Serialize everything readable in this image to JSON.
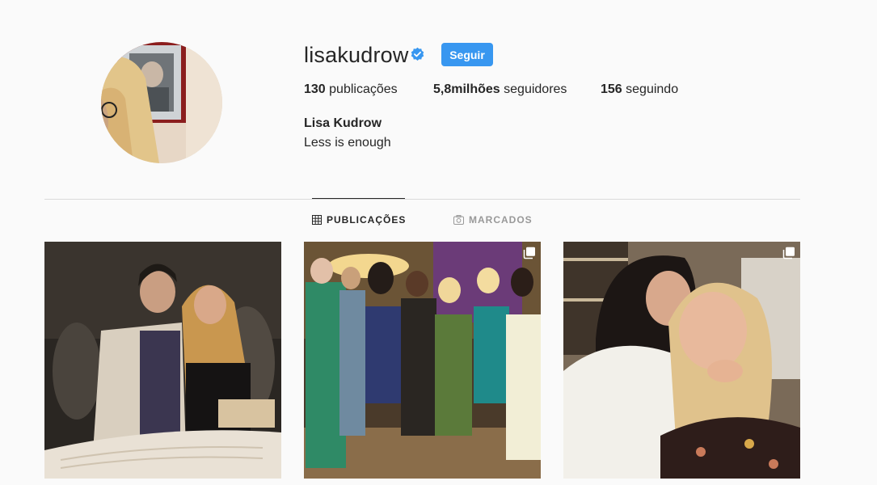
{
  "profile": {
    "username": "lisakudrow",
    "verified": true,
    "follow_label": "Seguir",
    "full_name": "Lisa Kudrow",
    "bio": "Less is enough",
    "stats": {
      "posts_count": "130",
      "posts_label": "publicações",
      "followers_count": "5,8milhões",
      "followers_label": "seguidores",
      "following_count": "156",
      "following_label": "seguindo"
    }
  },
  "tabs": [
    {
      "label": "PUBLICAÇÕES",
      "icon": "grid-icon",
      "active": true
    },
    {
      "label": "MARCADOS",
      "icon": "tagged-icon",
      "active": false
    }
  ],
  "posts": [
    {
      "type": "single"
    },
    {
      "type": "carousel"
    },
    {
      "type": "carousel"
    }
  ],
  "colors": {
    "accent": "#3897f0",
    "verified": "#3897f0",
    "text": "#262626",
    "muted": "#999999",
    "background": "#fafafa",
    "divider": "#dbdbdb"
  }
}
